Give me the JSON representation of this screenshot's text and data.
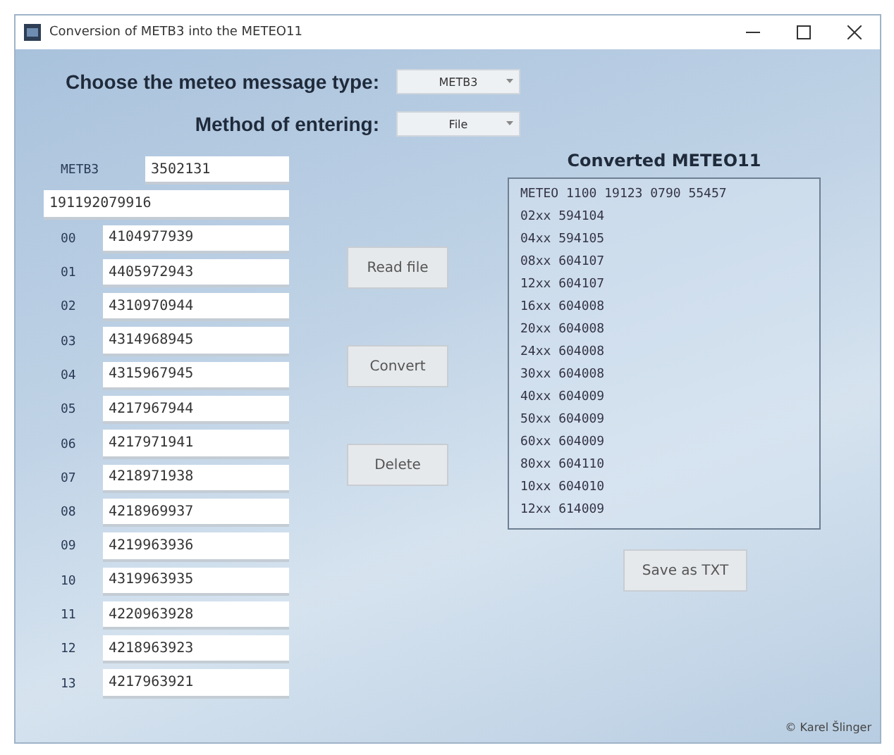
{
  "window": {
    "title": "Conversion of METB3 into the METEO11"
  },
  "message_type": {
    "label": "Choose the meteo message type:",
    "value": "METB3"
  },
  "entering_method": {
    "label": "Method of entering:",
    "value": "File"
  },
  "header_field": {
    "label": "METB3",
    "value": "3502131"
  },
  "date_field": {
    "value": "191192079916"
  },
  "levels": [
    {
      "label": "00",
      "value": "4104977939"
    },
    {
      "label": "01",
      "value": "4405972943"
    },
    {
      "label": "02",
      "value": "4310970944"
    },
    {
      "label": "03",
      "value": "4314968945"
    },
    {
      "label": "04",
      "value": "4315967945"
    },
    {
      "label": "05",
      "value": "4217967944"
    },
    {
      "label": "06",
      "value": "4217971941"
    },
    {
      "label": "07",
      "value": "4218971938"
    },
    {
      "label": "08",
      "value": "4218969937"
    },
    {
      "label": "09",
      "value": "4219963936"
    },
    {
      "label": "10",
      "value": "4319963935"
    },
    {
      "label": "11",
      "value": "4220963928"
    },
    {
      "label": "12",
      "value": "4218963923"
    },
    {
      "label": "13",
      "value": "4217963921"
    }
  ],
  "buttons": [
    "Read file",
    "Convert",
    "Delete"
  ],
  "output": {
    "title": "Converted METEO11",
    "lines": [
      "METEO 1100 19123 0790 55457",
      "02xx 594104",
      "04xx 594105",
      "08xx 604107",
      "12xx 604107",
      "16xx 604008",
      "20xx 604008",
      "24xx 604008",
      "30xx 604008",
      "40xx 604009",
      "50xx 604009",
      "60xx 604009",
      "80xx 604110",
      "10xx 604010",
      "12xx 614009"
    ]
  },
  "save_button": "Save as TXT",
  "footer": "© Karel Šlinger"
}
